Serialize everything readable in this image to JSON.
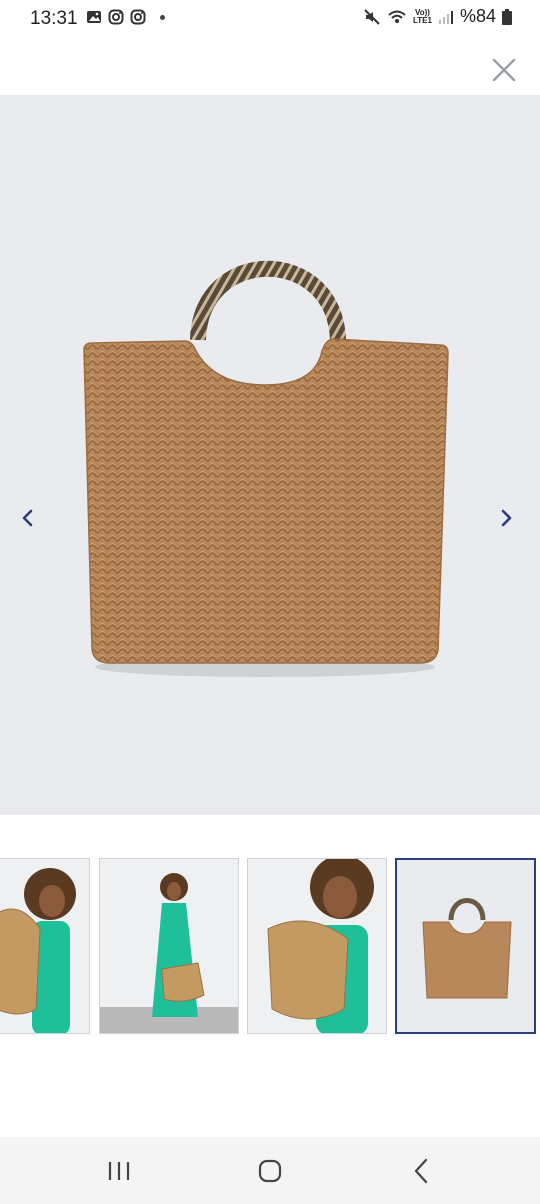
{
  "status_bar": {
    "time": "13:31",
    "network": "Vo))\nLTE1",
    "battery": "%84",
    "icons": [
      "gallery-icon",
      "instagram-icon",
      "instagram-icon",
      "notification-dot",
      "mute-icon",
      "wifi-icon",
      "signal-icon",
      "battery-icon"
    ]
  },
  "viewer": {
    "close_icon": "close-icon",
    "prev_icon": "chevron-left-icon",
    "next_icon": "chevron-right-icon",
    "accent_color": "#2b3f7a"
  },
  "thumbnails": [
    {
      "name": "model-side-with-bag",
      "active": false
    },
    {
      "name": "model-full-length-with-bag",
      "active": false
    },
    {
      "name": "model-bag-on-shoulder",
      "active": false
    },
    {
      "name": "bag-product-shot",
      "active": true
    }
  ],
  "nav_bar": {
    "icons": [
      "recent-apps-icon",
      "home-icon",
      "back-icon"
    ]
  }
}
